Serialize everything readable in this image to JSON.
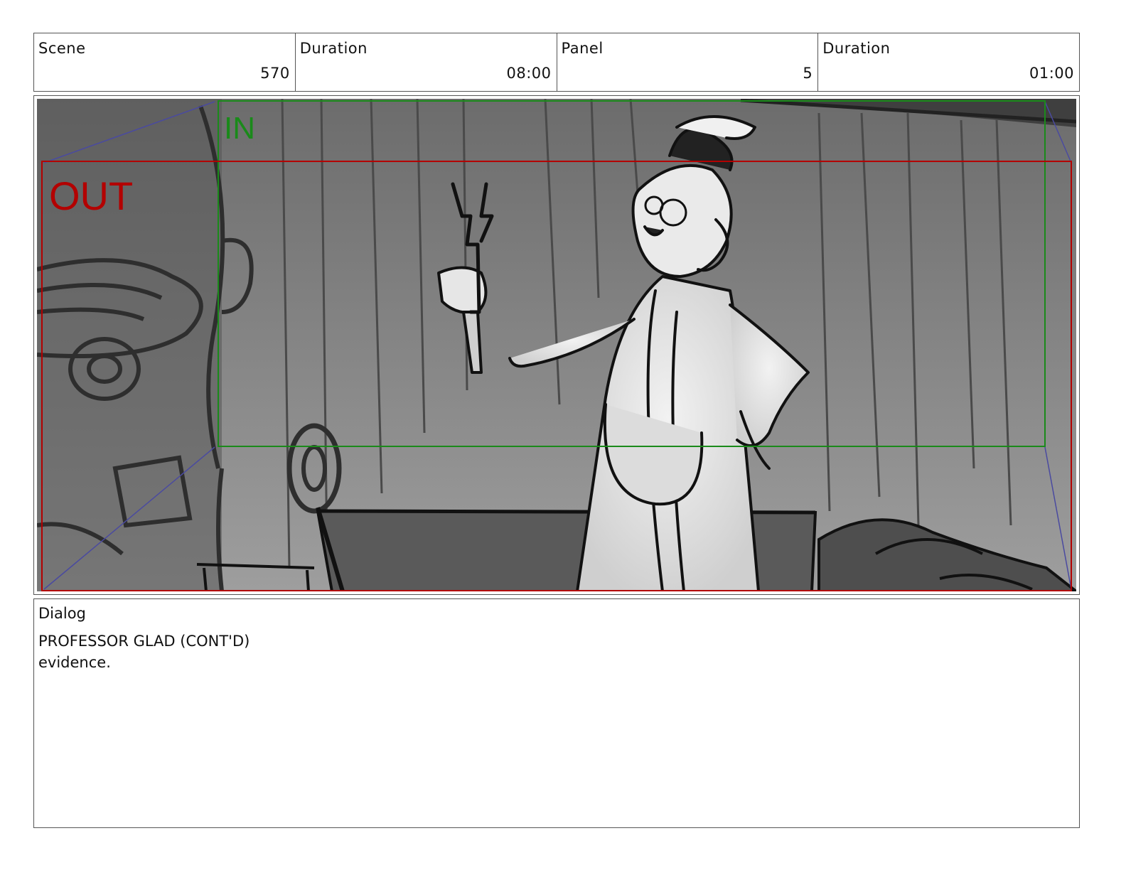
{
  "header": {
    "scene_label": "Scene",
    "scene_value": "570",
    "scene_duration_label": "Duration",
    "scene_duration_value": "08:00",
    "panel_label": "Panel",
    "panel_value": "5",
    "panel_duration_label": "Duration",
    "panel_duration_value": "01:00"
  },
  "panel": {
    "in_label": "IN",
    "out_label": "OUT",
    "in_color": "#1a8a1a",
    "out_color": "#b30000",
    "camera_guide_color": "#4a4aa0"
  },
  "dialog": {
    "label": "Dialog",
    "character": "PROFESSOR GLAD (CONT'D)",
    "line": "evidence."
  }
}
